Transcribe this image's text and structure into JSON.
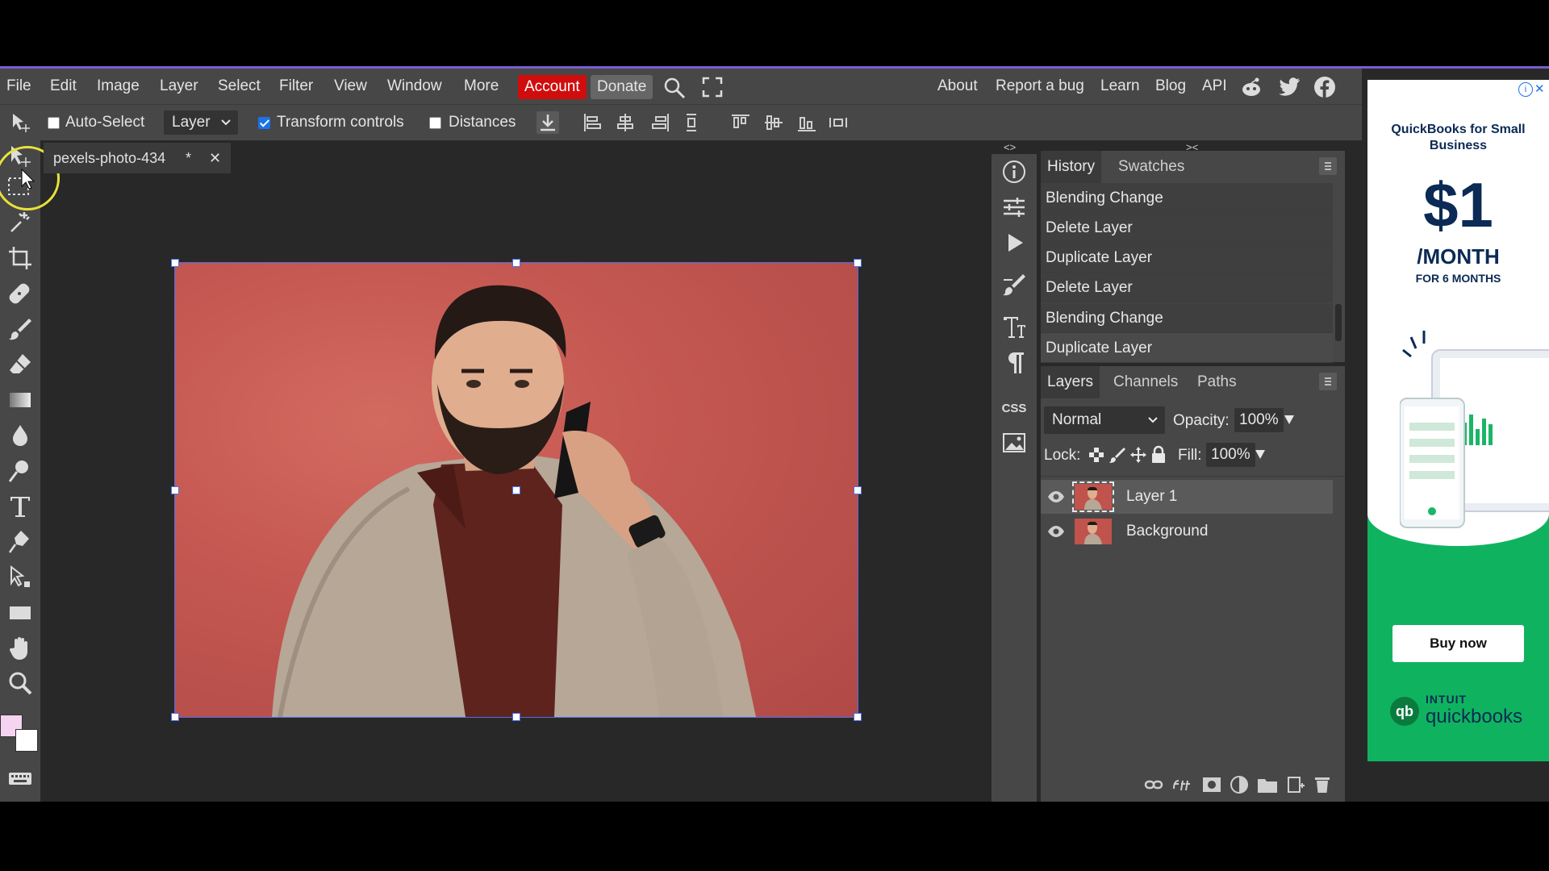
{
  "menubar": {
    "items": [
      "File",
      "Edit",
      "Image",
      "Layer",
      "Select",
      "Filter",
      "View",
      "Window",
      "More"
    ],
    "account_label": "Account",
    "donate_label": "Donate",
    "right_links": [
      "About",
      "Report a bug",
      "Learn",
      "Blog",
      "API"
    ],
    "social_icons": [
      "reddit-icon",
      "twitter-icon",
      "facebook-icon"
    ]
  },
  "options": {
    "auto_select_label": "Auto-Select",
    "auto_select_checked": false,
    "layer_select_value": "Layer",
    "transform_controls_label": "Transform controls",
    "transform_controls_checked": true,
    "distances_label": "Distances",
    "distances_checked": false
  },
  "document": {
    "tab_title": "pexels-photo-434",
    "modified_marker": "*",
    "close_glyph": "✕"
  },
  "history": {
    "tabs": [
      "History",
      "Swatches"
    ],
    "entries": [
      "Blending Change",
      "Delete Layer",
      "Duplicate Layer",
      "Delete Layer",
      "Blending Change",
      "Duplicate Layer"
    ]
  },
  "layers": {
    "tabs": [
      "Layers",
      "Channels",
      "Paths"
    ],
    "blend_mode": "Normal",
    "opacity_label": "Opacity:",
    "opacity_value": "100%",
    "lock_label": "Lock:",
    "fill_label": "Fill:",
    "fill_value": "100%",
    "items": [
      {
        "name": "Layer 1",
        "selected": true
      },
      {
        "name": "Background",
        "selected": false
      }
    ]
  },
  "sidecol": {
    "css_label": "CSS",
    "collapse_left": "<>",
    "collapse_right": "><"
  },
  "ad": {
    "headline": "QuickBooks for Small Business",
    "price": "$1",
    "per": "/MONTH",
    "duration": "FOR 6 MONTHS",
    "cta": "Buy now",
    "brand_top": "INTUIT",
    "brand_bottom": "quickbooks"
  },
  "colors": {
    "accent_red": "#d10c0c",
    "primary_swatch": "#f6d3f0",
    "secondary_swatch": "#ffffff",
    "ad_green": "#0fb35f",
    "ad_navy": "#0b2a55"
  }
}
